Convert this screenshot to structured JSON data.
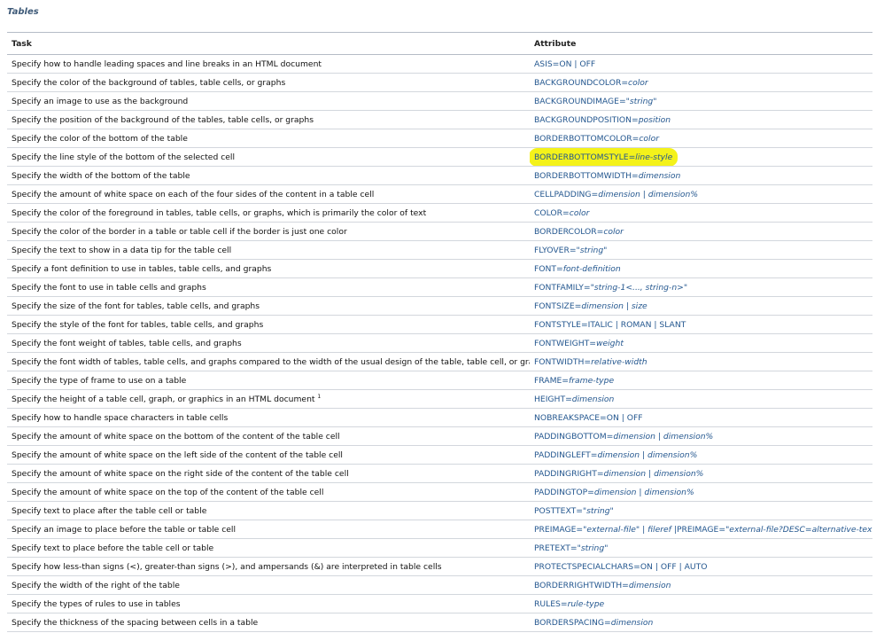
{
  "caption": "Tables",
  "columns": {
    "task": "Task",
    "attribute": "Attribute"
  },
  "rows": [
    {
      "task": "Specify how to handle leading spaces and line breaks in an HTML document",
      "attr": [
        {
          "t": "ASIS=ON | OFF",
          "i": false
        }
      ]
    },
    {
      "task": "Specify the color of the background of tables, table cells, or graphs",
      "attr": [
        {
          "t": "BACKGROUNDCOLOR=",
          "i": false
        },
        {
          "t": "color",
          "i": true
        }
      ]
    },
    {
      "task": "Specify an image to use as the background",
      "attr": [
        {
          "t": "BACKGROUNDIMAGE=",
          "i": false
        },
        {
          "t": "\"string\"",
          "i": true
        }
      ]
    },
    {
      "task": "Specify the position of the background of the tables, table cells, or graphs",
      "attr": [
        {
          "t": "BACKGROUNDPOSITION=",
          "i": false
        },
        {
          "t": "position",
          "i": true
        }
      ]
    },
    {
      "task": "Specify the color of the bottom of the table",
      "attr": [
        {
          "t": "BORDERBOTTOMCOLOR=",
          "i": false
        },
        {
          "t": "color",
          "i": true
        }
      ]
    },
    {
      "task": "Specify the line style of the bottom of the selected cell",
      "attr": [
        {
          "t": "BORDERBOTTOMSTYLE=",
          "i": false
        },
        {
          "t": "line-style",
          "i": true
        }
      ],
      "highlight": true
    },
    {
      "task": "Specify the width of the bottom of the table",
      "attr": [
        {
          "t": "BORDERBOTTOMWIDTH=",
          "i": false
        },
        {
          "t": "dimension",
          "i": true
        }
      ]
    },
    {
      "task": "Specify the amount of white space on each of the four sides of the content in a table cell",
      "attr": [
        {
          "t": "CELLPADDING=",
          "i": false
        },
        {
          "t": "dimension",
          "i": true
        },
        {
          "t": " | ",
          "i": false
        },
        {
          "t": "dimension%",
          "i": true
        }
      ]
    },
    {
      "task": "Specify the color of the foreground in tables, table cells, or graphs, which is primarily the color of text",
      "attr": [
        {
          "t": "COLOR=",
          "i": false
        },
        {
          "t": "color",
          "i": true
        }
      ]
    },
    {
      "task": "Specify the color of the border in a table or table cell if the border is just one color",
      "attr": [
        {
          "t": "BORDERCOLOR=",
          "i": false
        },
        {
          "t": "color",
          "i": true
        }
      ]
    },
    {
      "task": "Specify the text to show in a data tip for the table cell",
      "attr": [
        {
          "t": "FLYOVER=",
          "i": false
        },
        {
          "t": "\"string\"",
          "i": true
        }
      ]
    },
    {
      "task": "Specify a font definition to use in tables, table cells, and graphs",
      "attr": [
        {
          "t": "FONT=",
          "i": false
        },
        {
          "t": "font-definition",
          "i": true
        }
      ]
    },
    {
      "task": "Specify the font to use in table cells and graphs",
      "attr": [
        {
          "t": "FONTFAMILY=",
          "i": false
        },
        {
          "t": "\"string-1<..., string-n>\"",
          "i": true
        }
      ]
    },
    {
      "task": "Specify the size of the font for tables, table cells, and graphs",
      "attr": [
        {
          "t": "FONTSIZE=",
          "i": false
        },
        {
          "t": "dimension",
          "i": true
        },
        {
          "t": " | ",
          "i": false
        },
        {
          "t": "size",
          "i": true
        }
      ]
    },
    {
      "task": "Specify the style of the font for tables, table cells, and graphs",
      "attr": [
        {
          "t": "FONTSTYLE=ITALIC | ROMAN | SLANT",
          "i": false
        }
      ]
    },
    {
      "task": "Specify the font weight of tables, table cells, and graphs",
      "attr": [
        {
          "t": "FONTWEIGHT=",
          "i": false
        },
        {
          "t": "weight",
          "i": true
        }
      ]
    },
    {
      "task": "Specify the font width of tables, table cells, and graphs compared to the width of the usual design of the table, table cell, or graph",
      "attr": [
        {
          "t": "FONTWIDTH=",
          "i": false
        },
        {
          "t": "relative-width",
          "i": true
        }
      ]
    },
    {
      "task": "Specify the type of frame to use on a table",
      "attr": [
        {
          "t": "FRAME=",
          "i": false
        },
        {
          "t": "frame-type",
          "i": true
        }
      ]
    },
    {
      "task": "Specify the height of a table cell, graph, or graphics in an HTML document",
      "sup": "1",
      "attr": [
        {
          "t": "HEIGHT=",
          "i": false
        },
        {
          "t": "dimension",
          "i": true
        }
      ]
    },
    {
      "task": "Specify how to handle space characters in table cells",
      "attr": [
        {
          "t": "NOBREAKSPACE=ON | OFF",
          "i": false
        }
      ]
    },
    {
      "task": "Specify the amount of white space on the bottom of the content of the table cell",
      "attr": [
        {
          "t": "PADDINGBOTTOM=",
          "i": false
        },
        {
          "t": "dimension",
          "i": true
        },
        {
          "t": " | ",
          "i": false
        },
        {
          "t": "dimension%",
          "i": true
        }
      ]
    },
    {
      "task": "Specify the amount of white space on the left side of the content of the table cell",
      "attr": [
        {
          "t": "PADDINGLEFT=",
          "i": false
        },
        {
          "t": "dimension",
          "i": true
        },
        {
          "t": " | ",
          "i": false
        },
        {
          "t": "dimension%",
          "i": true
        }
      ]
    },
    {
      "task": "Specify the amount of white space on the right side of the content of the table cell",
      "attr": [
        {
          "t": "PADDINGRIGHT=",
          "i": false
        },
        {
          "t": "dimension",
          "i": true
        },
        {
          "t": " | ",
          "i": false
        },
        {
          "t": "dimension%",
          "i": true
        }
      ]
    },
    {
      "task": "Specify the amount of white space on the top of the content of the table cell",
      "attr": [
        {
          "t": "PADDINGTOP=",
          "i": false
        },
        {
          "t": "dimension",
          "i": true
        },
        {
          "t": " | ",
          "i": false
        },
        {
          "t": "dimension%",
          "i": true
        }
      ]
    },
    {
      "task": "Specify text to place after the table cell or table",
      "attr": [
        {
          "t": "POSTTEXT=",
          "i": false
        },
        {
          "t": "\"string\"",
          "i": true
        }
      ]
    },
    {
      "task": "Specify an image to place before the table or table cell",
      "attr": [
        {
          "t": "PREIMAGE=",
          "i": false
        },
        {
          "t": "\"external-file\"",
          "i": true
        },
        {
          "t": " | ",
          "i": false
        },
        {
          "t": "fileref",
          "i": true
        },
        {
          "t": " |PREIMAGE=",
          "i": false
        },
        {
          "t": "\"external-file?DESC=alternative-text\"",
          "i": true
        }
      ]
    },
    {
      "task": "Specify text to place before the table cell or table",
      "attr": [
        {
          "t": "PRETEXT=",
          "i": false
        },
        {
          "t": "\"string\"",
          "i": true
        }
      ]
    },
    {
      "task": "Specify how less-than signs (<), greater-than signs (>), and ampersands (&) are interpreted in table cells",
      "attr": [
        {
          "t": "PROTECTSPECIALCHARS=ON | OFF | AUTO",
          "i": false
        }
      ]
    },
    {
      "task": "Specify the width of the right of the table",
      "attr": [
        {
          "t": "BORDERRIGHTWIDTH=",
          "i": false
        },
        {
          "t": "dimension",
          "i": true
        }
      ]
    },
    {
      "task": "Specify the types of rules to use in tables",
      "attr": [
        {
          "t": "RULES=",
          "i": false
        },
        {
          "t": "rule-type",
          "i": true
        }
      ]
    },
    {
      "task": "Specify the thickness of the spacing between cells in a table",
      "attr": [
        {
          "t": "BORDERSPACING=",
          "i": false
        },
        {
          "t": "dimension",
          "i": true
        }
      ]
    }
  ],
  "colors": {
    "attribute_text": "#24578f",
    "highlight": "#f4f21a",
    "caption": "#3e5a78"
  }
}
